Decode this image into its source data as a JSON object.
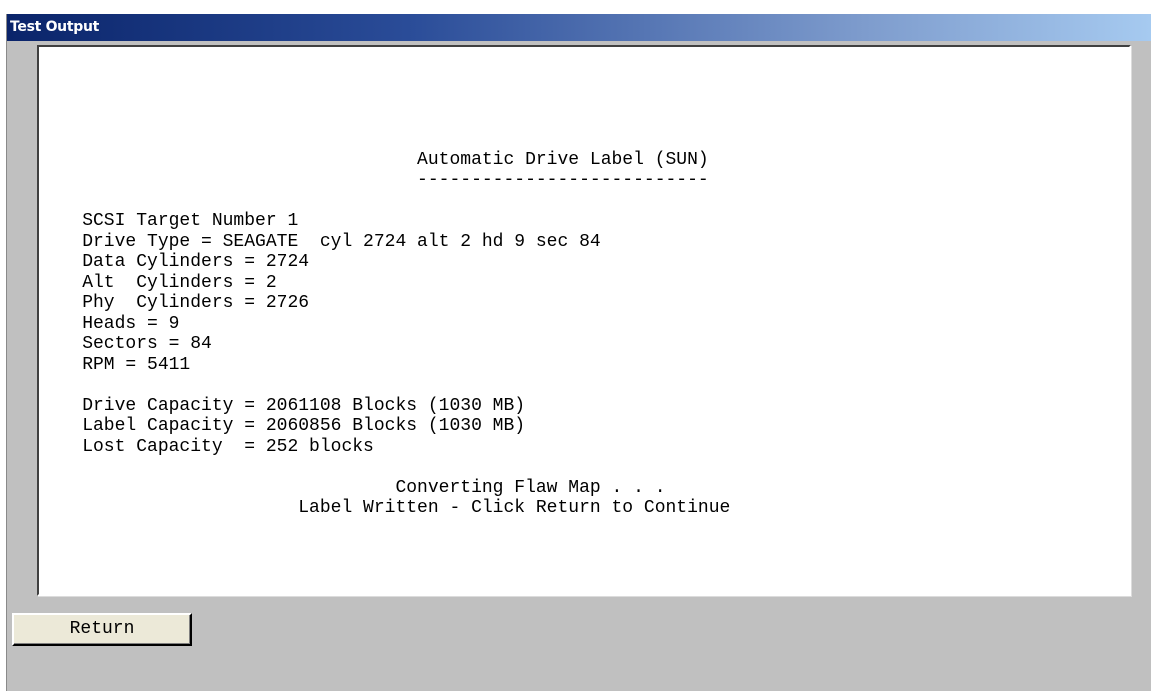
{
  "window": {
    "title": "Test Output"
  },
  "output": {
    "lines": [
      "",
      "",
      "",
      "",
      "",
      "                                   Automatic Drive Label (SUN)",
      "                                   ---------------------------",
      "",
      "    SCSI Target Number 1",
      "    Drive Type = SEAGATE  cyl 2724 alt 2 hd 9 sec 84",
      "    Data Cylinders = 2724",
      "    Alt  Cylinders = 2",
      "    Phy  Cylinders = 2726",
      "    Heads = 9",
      "    Sectors = 84",
      "    RPM = 5411",
      "",
      "    Drive Capacity = 2061108 Blocks (1030 MB)",
      "    Label Capacity = 2060856 Blocks (1030 MB)",
      "    Lost Capacity  = 252 blocks",
      "",
      "                                 Converting Flaw Map . . .",
      "                        Label Written - Click Return to Continue"
    ]
  },
  "buttons": {
    "return_label": "Return"
  },
  "colors": {
    "titlebar_start": "#0a246a",
    "titlebar_end": "#a6caf0",
    "window_bg": "#c0c0c0",
    "panel_bg": "#ffffff"
  }
}
